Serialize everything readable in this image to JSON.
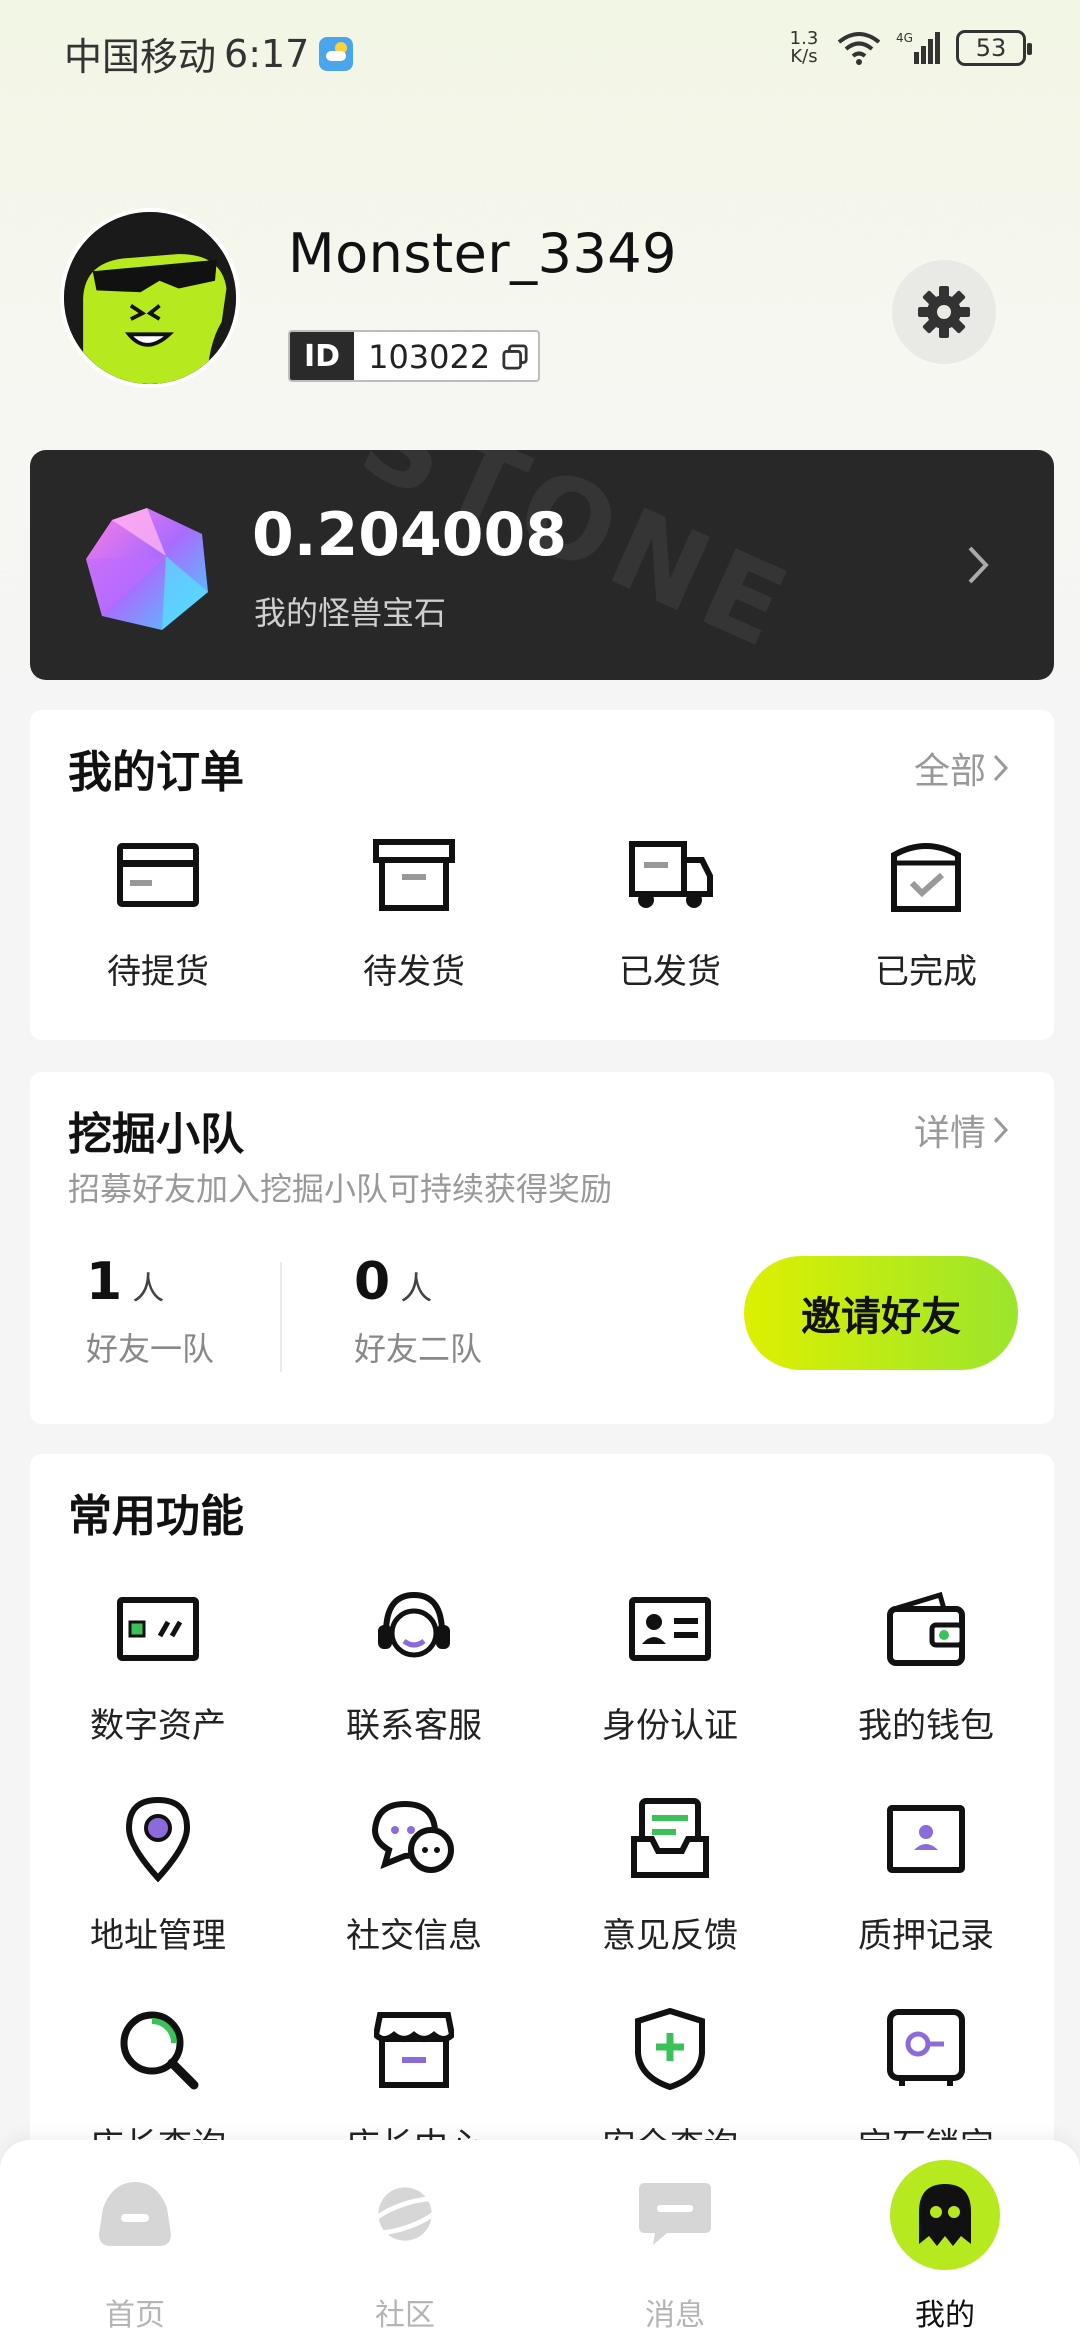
{
  "status_bar": {
    "carrier": "中国移动",
    "time": "6:17",
    "speed_top": "1.3",
    "speed_unit": "K/s",
    "network": "4G",
    "battery": "53"
  },
  "profile": {
    "username": "Monster_3349",
    "id_tag": "ID",
    "id_value": "103022"
  },
  "gem_card": {
    "value": "0.204008",
    "label": "我的怪兽宝石",
    "watermark": "STONE"
  },
  "orders": {
    "title": "我的订单",
    "link": "全部",
    "items": [
      {
        "label": "待提货",
        "icon": "card-icon"
      },
      {
        "label": "待发货",
        "icon": "box-icon"
      },
      {
        "label": "已发货",
        "icon": "truck-icon"
      },
      {
        "label": "已完成",
        "icon": "check-bag-icon"
      }
    ]
  },
  "team": {
    "title": "挖掘小队",
    "link": "详情",
    "subtitle": "招募好友加入挖掘小队可持续获得奖励",
    "stats": [
      {
        "count": "1",
        "unit": "人",
        "label": "好友一队"
      },
      {
        "count": "0",
        "unit": "人",
        "label": "好友二队"
      }
    ],
    "invite_label": "邀请好友"
  },
  "functions": {
    "title": "常用功能",
    "items": [
      {
        "label": "数字资产",
        "icon": "digital-asset-icon"
      },
      {
        "label": "联系客服",
        "icon": "headset-icon"
      },
      {
        "label": "身份认证",
        "icon": "id-card-icon"
      },
      {
        "label": "我的钱包",
        "icon": "wallet-icon"
      },
      {
        "label": "地址管理",
        "icon": "location-icon"
      },
      {
        "label": "社交信息",
        "icon": "chat-icon"
      },
      {
        "label": "意见反馈",
        "icon": "feedback-icon"
      },
      {
        "label": "质押记录",
        "icon": "pledge-icon"
      },
      {
        "label": "店长查询",
        "icon": "search-icon"
      },
      {
        "label": "店长中心",
        "icon": "store-icon"
      },
      {
        "label": "安全查询",
        "icon": "shield-icon"
      },
      {
        "label": "宝石锁定",
        "icon": "safe-icon"
      }
    ]
  },
  "bottom_nav": {
    "items": [
      {
        "label": "首页",
        "icon": "home-icon",
        "active": false
      },
      {
        "label": "社区",
        "icon": "planet-icon",
        "active": false
      },
      {
        "label": "消息",
        "icon": "message-icon",
        "active": false
      },
      {
        "label": "我的",
        "icon": "ghost-icon",
        "active": true
      }
    ]
  },
  "colors": {
    "accent": "#b6ea1f",
    "card_dark": "#282828",
    "purple": "#8a6bd9",
    "green": "#3bc15a"
  }
}
